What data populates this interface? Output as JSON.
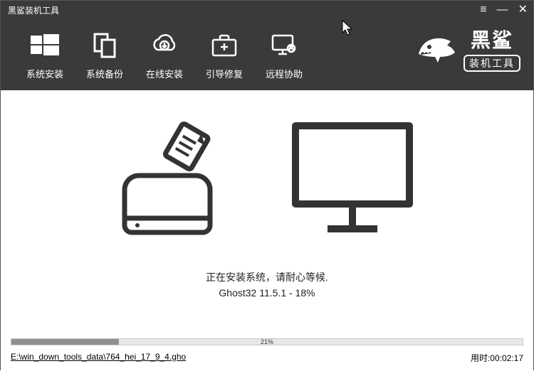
{
  "titlebar": {
    "title": "黑鲨装机工具"
  },
  "toolbar": {
    "items": [
      {
        "label": "系统安装"
      },
      {
        "label": "系统备份"
      },
      {
        "label": "在线安装"
      },
      {
        "label": "引导修复"
      },
      {
        "label": "远程协助"
      }
    ]
  },
  "brand": {
    "line1": "黑鲨",
    "line2": "装机工具"
  },
  "status": {
    "message": "正在安装系统，请耐心等候.",
    "detail": "Ghost32 11.5.1 - 18%"
  },
  "progress": {
    "percent_label": "21%",
    "percent_value": 21
  },
  "footer": {
    "filepath": "E:\\win_down_tools_data\\764_hei_17_9_4.gho",
    "elapsed_prefix": "用时:",
    "elapsed_time": "00:02:17"
  }
}
